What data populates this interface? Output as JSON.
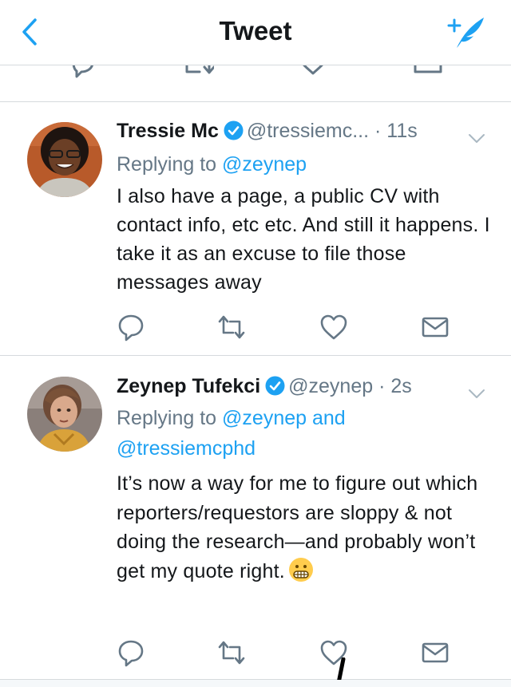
{
  "nav": {
    "title": "Tweet",
    "back_icon": "chevron-left-icon",
    "compose_icon": "compose-tweet-icon",
    "accent_color": "#1da1f2"
  },
  "tweets": [
    {
      "name": "Tressie Mc",
      "handle": "@tressiemc...",
      "time": "· 11s",
      "verified": true,
      "replying_prefix": "Replying to",
      "replying_to": "@zeynep",
      "text": "I also have a page, a public CV with contact info, etc etc. And still it happens. I take it as an excuse to file those messages away"
    },
    {
      "name": "Zeynep Tufekci",
      "handle": "@zeynep",
      "time": "· 2s",
      "verified": true,
      "replying_prefix": "Replying to",
      "replying_to": "@zeynep and",
      "replying_to_2": "@tressiemcphd",
      "text": "It’s now a way for me to figure out which reporters/requestors are sloppy & not doing the research—and probably won’t get my quote right.",
      "emoji": "grimacing-face-emoji"
    }
  ],
  "actions": [
    "reply-icon",
    "retweet-icon",
    "like-icon",
    "direct-message-icon"
  ],
  "colors": {
    "text": "#14171a",
    "secondary": "#657786",
    "divider": "#d6dadd",
    "verified": "#1da1f2"
  }
}
